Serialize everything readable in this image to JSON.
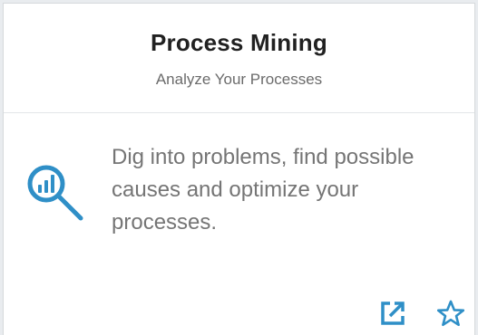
{
  "card": {
    "title": "Process Mining",
    "subtitle": "Analyze Your Processes",
    "description": "Dig into problems, find possible causes and optimize your processes.",
    "icon": "analytics-search-icon",
    "actions": [
      {
        "name": "open-in-new-icon"
      },
      {
        "name": "star-outline-icon"
      }
    ]
  },
  "colors": {
    "accent": "#2f8fc7",
    "title": "#212121",
    "subtitle": "#6b6b6b",
    "description": "#757575",
    "divider": "#e3e5e8"
  }
}
